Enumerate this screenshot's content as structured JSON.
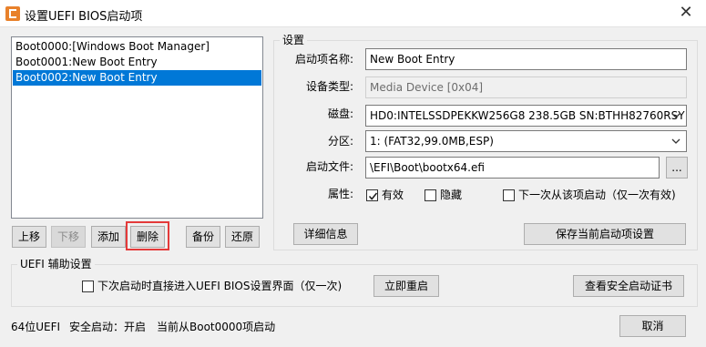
{
  "window": {
    "title": "设置UEFI BIOS启动项",
    "close_glyph": "✕"
  },
  "boot_list": {
    "items": [
      {
        "label": "Boot0000:[Windows Boot Manager]",
        "selected": false
      },
      {
        "label": "Boot0001:New Boot Entry",
        "selected": false
      },
      {
        "label": "Boot0002:New Boot Entry",
        "selected": true
      }
    ]
  },
  "list_buttons": {
    "up": "上移",
    "down": "下移",
    "add": "添加",
    "delete": "删除",
    "backup": "备份",
    "restore": "还原"
  },
  "settings": {
    "group_title": "设置",
    "name_label": "启动项名称:",
    "name_value": "New Boot Entry",
    "device_type_label": "设备类型:",
    "device_type_value": "Media Device [0x04]",
    "disk_label": "磁盘:",
    "disk_value": "HD0:INTELSSDPEKKW256G8 238.5GB SN:BTHH82760RSY",
    "partition_label": "分区:",
    "partition_value": "1: (FAT32,99.0MB,ESP)",
    "boot_file_label": "启动文件:",
    "boot_file_value": "\\EFI\\Boot\\bootx64.efi",
    "browse_label": "...",
    "attributes_label": "属性:",
    "attr_active": {
      "label": "有效",
      "checked": true
    },
    "attr_hidden": {
      "label": "隐藏",
      "checked": false
    },
    "attr_next_boot": {
      "label": "下一次从该项启动（仅一次有效)",
      "checked": false
    },
    "details_button": "详细信息",
    "save_button": "保存当前启动项设置"
  },
  "uefi_helper": {
    "group_title": "UEFI 辅助设置",
    "enter_bios_checkbox": {
      "label": "下次启动时直接进入UEFI BIOS设置界面（仅一次)",
      "checked": false
    },
    "reboot_button": "立即重启",
    "view_cert_button": "查看安全启动证书"
  },
  "status_bar": {
    "mode": "64位UEFI",
    "secure_boot": "安全启动：开启",
    "current_boot": "当前从Boot0000项启动"
  },
  "footer": {
    "cancel_button": "取消"
  },
  "colors": {
    "selection": "#0078d7",
    "highlight_border": "#e43a3a"
  }
}
